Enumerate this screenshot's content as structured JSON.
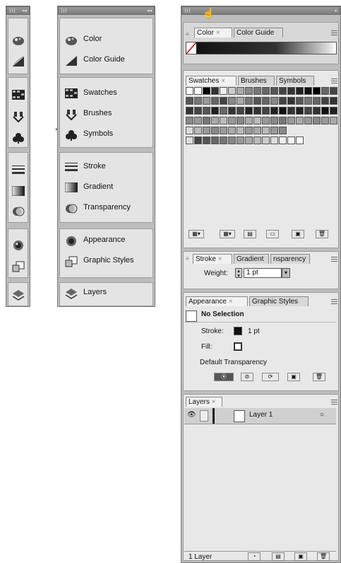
{
  "panel_collapsed": {
    "icons": [
      "color-icon",
      "color-guide-icon",
      "swatches-icon",
      "brushes-icon",
      "symbols-icon",
      "stroke-icon",
      "gradient-icon",
      "transparency-icon",
      "appearance-icon",
      "graphic-styles-icon",
      "layers-icon"
    ]
  },
  "panel_expanded": {
    "items": [
      {
        "label": "Color"
      },
      {
        "label": "Color Guide"
      },
      {
        "label": "Swatches"
      },
      {
        "label": "Brushes"
      },
      {
        "label": "Symbols"
      },
      {
        "label": "Stroke"
      },
      {
        "label": "Gradient"
      },
      {
        "label": "Transparency"
      },
      {
        "label": "Appearance"
      },
      {
        "label": "Graphic Styles"
      },
      {
        "label": "Layers"
      }
    ]
  },
  "color_panel": {
    "tabs": [
      "Color",
      "Color Guide"
    ]
  },
  "swatches_panel": {
    "tabs": [
      "Swatches",
      "Brushes",
      "Symbols"
    ]
  },
  "stroke_panel": {
    "tabs": [
      "Stroke",
      "Gradient",
      "nsparency"
    ],
    "weight_label": "Weight:",
    "weight_value": "1 pt"
  },
  "appearance_panel": {
    "tabs": [
      "Appearance",
      "Graphic Styles"
    ],
    "selection": "No Selection",
    "stroke_label": "Stroke:",
    "stroke_value": "1 pt",
    "fill_label": "Fill:",
    "transparency": "Default Transparency"
  },
  "layers_panel": {
    "tabs": [
      "Layers"
    ],
    "layer_name": "Layer 1",
    "footer": "1 Layer"
  },
  "colors": {
    "panel_bg": "#e4e4e4",
    "bar": "#8a8a8a",
    "ink": "#111111"
  }
}
